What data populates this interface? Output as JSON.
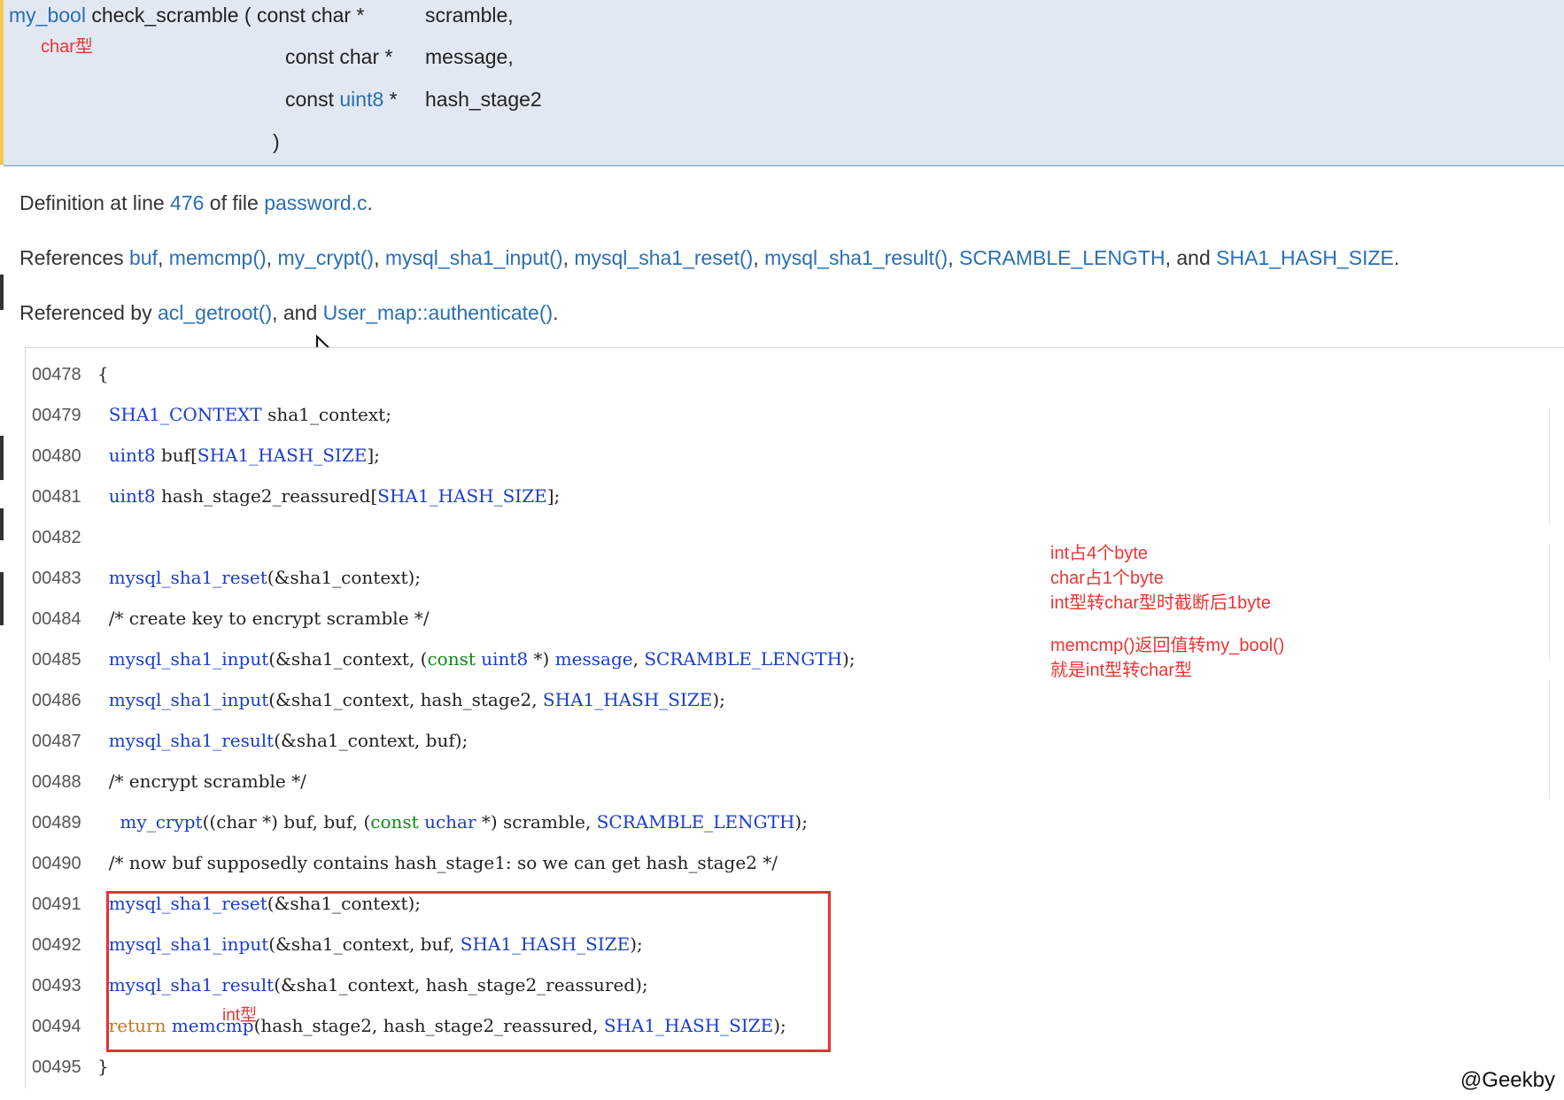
{
  "signature": {
    "return_type": "my_bool",
    "function_name": "check_scramble",
    "open_paren": "(",
    "params": [
      {
        "qualifier": "const char *",
        "qualifier_prefix": "",
        "qualifier_link": "",
        "qualifier_suffix": "",
        "name": "scramble,"
      },
      {
        "qualifier": "const char *",
        "qualifier_prefix": "",
        "qualifier_link": "",
        "qualifier_suffix": "",
        "name": "message,"
      },
      {
        "qualifier": "",
        "qualifier_prefix": "const ",
        "qualifier_link": "uint8",
        "qualifier_suffix": " *",
        "name": "hash_stage2"
      }
    ],
    "close_paren": ")",
    "annotation": "char型"
  },
  "definition": {
    "prefix": "Definition at line ",
    "line": "476",
    "middle": " of file ",
    "file": "password.c",
    "suffix": "."
  },
  "references": {
    "prefix": "References ",
    "items": [
      "buf",
      "memcmp()",
      "my_crypt()",
      "mysql_sha1_input()",
      "mysql_sha1_reset()",
      "mysql_sha1_result()",
      "SCRAMBLE_LENGTH"
    ],
    "joiner": ", ",
    "and_text": ", and ",
    "last": "SHA1_HASH_SIZE",
    "suffix": "."
  },
  "referenced_by": {
    "prefix": "Referenced by ",
    "first": "acl_getroot()",
    "and_text": ", and ",
    "last": "User_map::authenticate()",
    "suffix": "."
  },
  "code": {
    "lines": [
      {
        "num": "00478",
        "parts": [
          {
            "t": "{",
            "c": "cm"
          }
        ]
      },
      {
        "num": "00479",
        "parts": [
          {
            "t": "  SHA1_CONTEXT",
            "c": "kw"
          },
          {
            "t": " sha1_context;",
            "c": "cm"
          }
        ]
      },
      {
        "num": "00480",
        "parts": [
          {
            "t": "  uint8",
            "c": "kw"
          },
          {
            "t": " buf[",
            "c": "cm"
          },
          {
            "t": "SHA1_HASH_SIZE",
            "c": "kw"
          },
          {
            "t": "];",
            "c": "cm"
          }
        ]
      },
      {
        "num": "00481",
        "parts": [
          {
            "t": "  uint8",
            "c": "kw"
          },
          {
            "t": " hash_stage2_reassured[",
            "c": "cm"
          },
          {
            "t": "SHA1_HASH_SIZE",
            "c": "kw"
          },
          {
            "t": "];",
            "c": "cm"
          }
        ]
      },
      {
        "num": "00482",
        "parts": []
      },
      {
        "num": "00483",
        "parts": [
          {
            "t": "  mysql_sha1_reset",
            "c": "kw"
          },
          {
            "t": "(&sha1_context);",
            "c": "cm"
          }
        ]
      },
      {
        "num": "00484",
        "parts": [
          {
            "t": "  /* create key to encrypt scramble */",
            "c": "cm"
          }
        ]
      },
      {
        "num": "00485",
        "parts": [
          {
            "t": "  mysql_sha1_input",
            "c": "kw"
          },
          {
            "t": "(&sha1_context, (",
            "c": "cm"
          },
          {
            "t": "const",
            "c": "tp"
          },
          {
            "t": " ",
            "c": "cm"
          },
          {
            "t": "uint8",
            "c": "kw"
          },
          {
            "t": " *) ",
            "c": "cm"
          },
          {
            "t": "message",
            "c": "kw"
          },
          {
            "t": ", ",
            "c": "cm"
          },
          {
            "t": "SCRAMBLE_LENGTH",
            "c": "kw"
          },
          {
            "t": ");",
            "c": "cm"
          }
        ]
      },
      {
        "num": "00486",
        "parts": [
          {
            "t": "  mysql_sha1_input",
            "c": "kw"
          },
          {
            "t": "(&sha1_context, hash_stage2, ",
            "c": "cm"
          },
          {
            "t": "SHA1_HASH_SIZE",
            "c": "kw"
          },
          {
            "t": ");",
            "c": "cm"
          }
        ]
      },
      {
        "num": "00487",
        "parts": [
          {
            "t": "  mysql_sha1_result",
            "c": "kw"
          },
          {
            "t": "(&sha1_context, buf);",
            "c": "cm"
          }
        ]
      },
      {
        "num": "00488",
        "parts": [
          {
            "t": "  /* encrypt scramble */",
            "c": "cm"
          }
        ]
      },
      {
        "num": "00489",
        "parts": [
          {
            "t": "    my_crypt",
            "c": "kw"
          },
          {
            "t": "((char *) buf, buf, (",
            "c": "cm"
          },
          {
            "t": "const",
            "c": "tp"
          },
          {
            "t": " ",
            "c": "cm"
          },
          {
            "t": "uchar",
            "c": "kw"
          },
          {
            "t": " *) scramble, ",
            "c": "cm"
          },
          {
            "t": "SCRAMBLE_LENGTH",
            "c": "kw"
          },
          {
            "t": ");",
            "c": "cm"
          }
        ]
      },
      {
        "num": "00490",
        "parts": [
          {
            "t": "  /* now buf supposedly contains hash_stage1: so we can get hash_stage2 */",
            "c": "cm"
          }
        ]
      },
      {
        "num": "00491",
        "parts": [
          {
            "t": "  mysql_sha1_reset",
            "c": "kw"
          },
          {
            "t": "(&sha1_context);",
            "c": "cm"
          }
        ]
      },
      {
        "num": "00492",
        "parts": [
          {
            "t": "  mysql_sha1_input",
            "c": "kw"
          },
          {
            "t": "(&sha1_context, buf, ",
            "c": "cm"
          },
          {
            "t": "SHA1_HASH_SIZE",
            "c": "kw"
          },
          {
            "t": ");",
            "c": "cm"
          }
        ]
      },
      {
        "num": "00493",
        "parts": [
          {
            "t": "  mysql_sha1_result",
            "c": "kw"
          },
          {
            "t": "(&sha1_context, hash_stage2_reassured);",
            "c": "cm"
          }
        ]
      },
      {
        "num": "00494",
        "parts": [
          {
            "t": "  return",
            "c": "rt"
          },
          {
            "t": " ",
            "c": "cm"
          },
          {
            "t": "memcmp",
            "c": "kw"
          },
          {
            "t": "(hash_stage2, hash_stage2_reassured, ",
            "c": "cm"
          },
          {
            "t": "SHA1_HASH_SIZE",
            "c": "kw"
          },
          {
            "t": ");",
            "c": "cm"
          }
        ]
      },
      {
        "num": "00495",
        "parts": [
          {
            "t": "}",
            "c": "cm"
          }
        ]
      }
    ]
  },
  "annotations": {
    "int_type": "int型",
    "notes": [
      "int占4个byte",
      "char占1个byte",
      "int型转char型时截断后1byte",
      "",
      "memcmp()返回值转my_bool()",
      "就是int型转char型"
    ]
  },
  "watermark": "@Geekby",
  "colors": {
    "signature_bg": "#e2e8f2",
    "link": "#2a6fb3",
    "code_keyword": "#1a3ccf",
    "annotation_red": "#ee3333",
    "highlight_box": "#e63030"
  }
}
